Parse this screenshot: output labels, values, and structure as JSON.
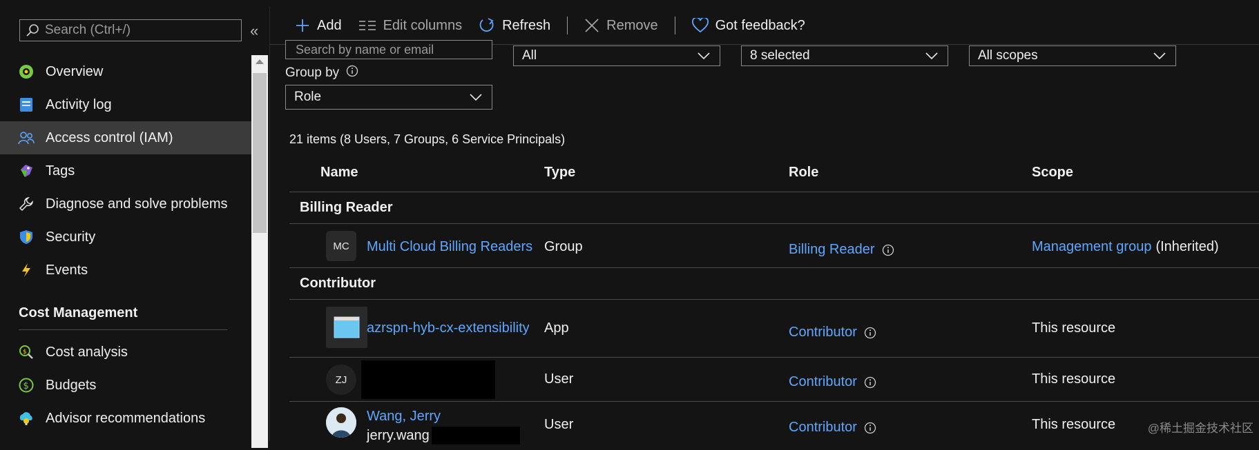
{
  "sidebar": {
    "search_placeholder": "Search (Ctrl+/)",
    "collapse_glyph": "«",
    "items": [
      {
        "label": "Overview",
        "icon": "overview-icon"
      },
      {
        "label": "Activity log",
        "icon": "activity-log-icon"
      },
      {
        "label": "Access control (IAM)",
        "icon": "iam-people-icon",
        "active": true
      },
      {
        "label": "Tags",
        "icon": "tag-icon"
      },
      {
        "label": "Diagnose and solve problems",
        "icon": "wrench-icon"
      },
      {
        "label": "Security",
        "icon": "shield-icon"
      },
      {
        "label": "Events",
        "icon": "lightning-icon"
      }
    ],
    "section_title": "Cost Management",
    "cost_items": [
      {
        "label": "Cost analysis",
        "icon": "cost-analysis-icon"
      },
      {
        "label": "Budgets",
        "icon": "budgets-icon"
      },
      {
        "label": "Advisor recommendations",
        "icon": "advisor-icon"
      }
    ]
  },
  "toolbar": {
    "add_label": "Add",
    "edit_columns_label": "Edit columns",
    "refresh_label": "Refresh",
    "remove_label": "Remove",
    "feedback_label": "Got feedback?"
  },
  "filters": {
    "search_placeholder": "Search by name or email",
    "type_value": "All",
    "role_value": "8 selected",
    "scope_value": "All scopes",
    "group_by_label": "Group by",
    "group_by_value": "Role"
  },
  "summary": "21 items (8 Users, 7 Groups, 6 Service Principals)",
  "table": {
    "columns": [
      "Name",
      "Type",
      "Role",
      "Scope"
    ],
    "groups": [
      {
        "title": "Billing Reader",
        "rows": [
          {
            "avatar": "MC",
            "name": "Multi Cloud Billing Readers",
            "type": "Group",
            "role": "Billing Reader",
            "scope_link": "Management group",
            "scope_suffix": "(Inherited)"
          }
        ]
      },
      {
        "title": "Contributor",
        "rows": [
          {
            "avatar_icon": "app-icon",
            "name": "azrspn-hyb-cx-extensibility",
            "type": "App",
            "role": "Contributor",
            "scope": "This resource"
          },
          {
            "avatar": "ZJ",
            "name": "",
            "type": "User",
            "role": "Contributor",
            "scope": "This resource"
          },
          {
            "avatar_icon": "user-photo-icon",
            "name": "Wang, Jerry",
            "subname": "jerry.wang",
            "type": "User",
            "role": "Contributor",
            "scope": "This resource"
          }
        ]
      }
    ]
  },
  "watermark": "@稀土掘金技术社区",
  "colors": {
    "accent": "#5ea6ff",
    "background": "#141414",
    "active": "#3b3b3b"
  }
}
